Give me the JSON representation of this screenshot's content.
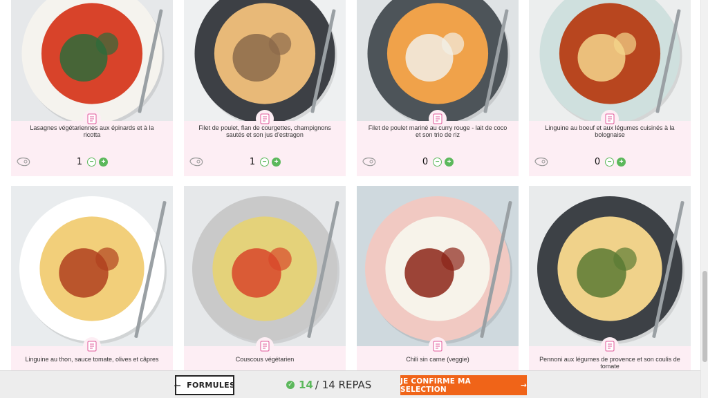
{
  "meals": [
    {
      "name": "Lasagnes végétariennes aux épinards et à la ricotta",
      "qty": "1",
      "plate": "#f5f3ee",
      "food": "#d8432a",
      "accent": "#2e6b3a",
      "bg": "#e6e8ea"
    },
    {
      "name": "Filet de poulet, flan de courgettes, champignons sautés et son jus d'estragon",
      "qty": "1",
      "plate": "#3d4045",
      "food": "#e8b978",
      "accent": "#8b6a4a",
      "bg": "#eef0f1"
    },
    {
      "name": "Filet de poulet mariné au curry rouge - lait de coco et son trio de riz",
      "qty": "0",
      "plate": "#4d5459",
      "food": "#f0a24a",
      "accent": "#f2efe6",
      "bg": "#dfe3e5"
    },
    {
      "name": "Linguine au boeuf et aux légumes cuisinés à la bolognaise",
      "qty": "0",
      "plate": "#cfe0de",
      "food": "#b8461f",
      "accent": "#f3d58c",
      "bg": "#eceeee"
    },
    {
      "name": "Linguine au thon, sauce tomate, olives et câpres",
      "qty": "",
      "plate": "#ffffff",
      "food": "#f2cf7a",
      "accent": "#b0401e",
      "bg": "#e9ecee"
    },
    {
      "name": "Couscous végétarien",
      "qty": "",
      "plate": "#c9c9c9",
      "food": "#e4d27a",
      "accent": "#d8472a",
      "bg": "#e6e8ea"
    },
    {
      "name": "Chili sin carne (veggie)",
      "qty": "",
      "plate": "#f1c9c2",
      "food": "#f7f3ea",
      "accent": "#8c2418",
      "bg": "#cfd9de"
    },
    {
      "name": "Pennoni aux légumes de provence et son coulis de tomate",
      "qty": "",
      "plate": "#3d4146",
      "food": "#f0d28a",
      "accent": "#5a7a33",
      "bg": "#e9ebec"
    }
  ],
  "bottom": {
    "formules_label": "FORMULES",
    "count_current": "14",
    "count_rest": "/ 14 REPAS",
    "confirm_label": "JE CONFIRME MA SELECTION"
  },
  "colors": {
    "accent_green": "#5cb85c",
    "accent_orange": "#f06418",
    "card_pink": "#fdeef4"
  }
}
